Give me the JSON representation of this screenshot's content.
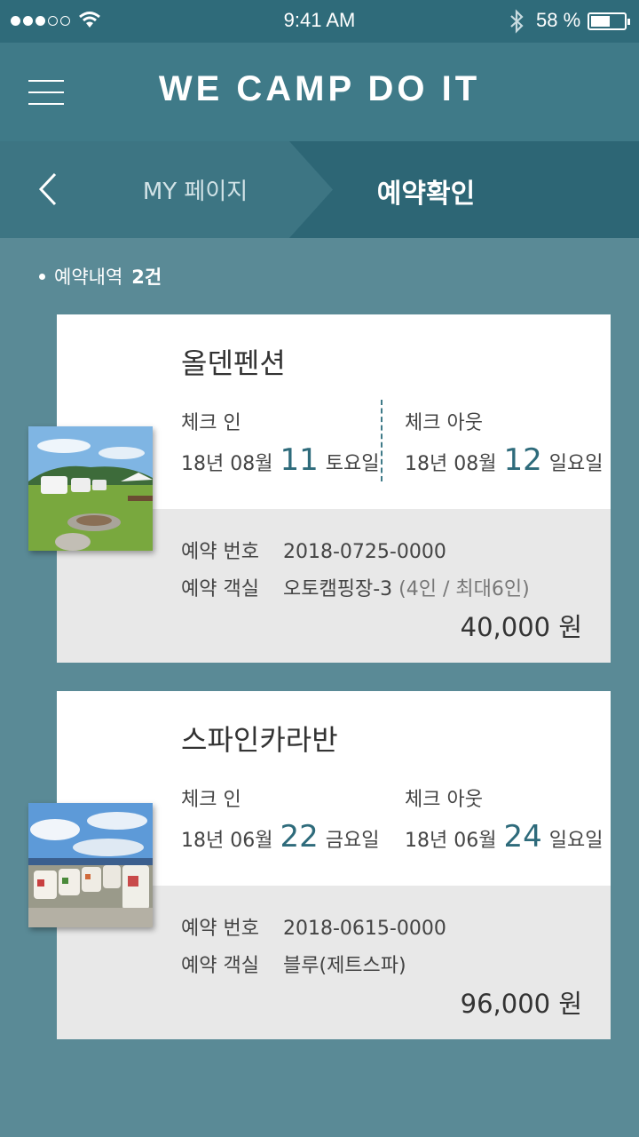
{
  "status_bar": {
    "time": "9:41 AM",
    "battery": "58 %",
    "battery_level": 0.58
  },
  "header": {
    "brand": "WE CAMP DO IT"
  },
  "breadcrumb": {
    "prev": "MY 페이지",
    "current": "예약확인"
  },
  "summary": {
    "label": "예약내역",
    "count": "2건"
  },
  "reservations": [
    {
      "name": "올덴펜션",
      "checkin_label": "체크 인",
      "checkin_prefix": "18년 08월",
      "checkin_day": "11",
      "checkin_weekday": "토요일",
      "checkout_label": "체크 아웃",
      "checkout_prefix": "18년 08월",
      "checkout_day": "12",
      "checkout_weekday": "일요일",
      "number_label": "예약 번호",
      "number": "2018-0725-0000",
      "room_label": "예약 객실",
      "room": "오토캠핑장-3",
      "room_note": "(4인 / 최대6인)",
      "price": "40,000 원"
    },
    {
      "name": "스파인카라반",
      "checkin_label": "체크 인",
      "checkin_prefix": "18년 06월",
      "checkin_day": "22",
      "checkin_weekday": "금요일",
      "checkout_label": "체크 아웃",
      "checkout_prefix": "18년 06월",
      "checkout_day": "24",
      "checkout_weekday": "일요일",
      "number_label": "예약 번호",
      "number": "2018-0615-0000",
      "room_label": "예약 객실",
      "room": "블루(제트스파)",
      "room_note": "",
      "price": "96,000 원"
    }
  ],
  "colors": {
    "background": "#5a8a96",
    "header": "#3f7a88",
    "breadcrumb": "#2d6675",
    "accent": "#2e6b7b"
  }
}
